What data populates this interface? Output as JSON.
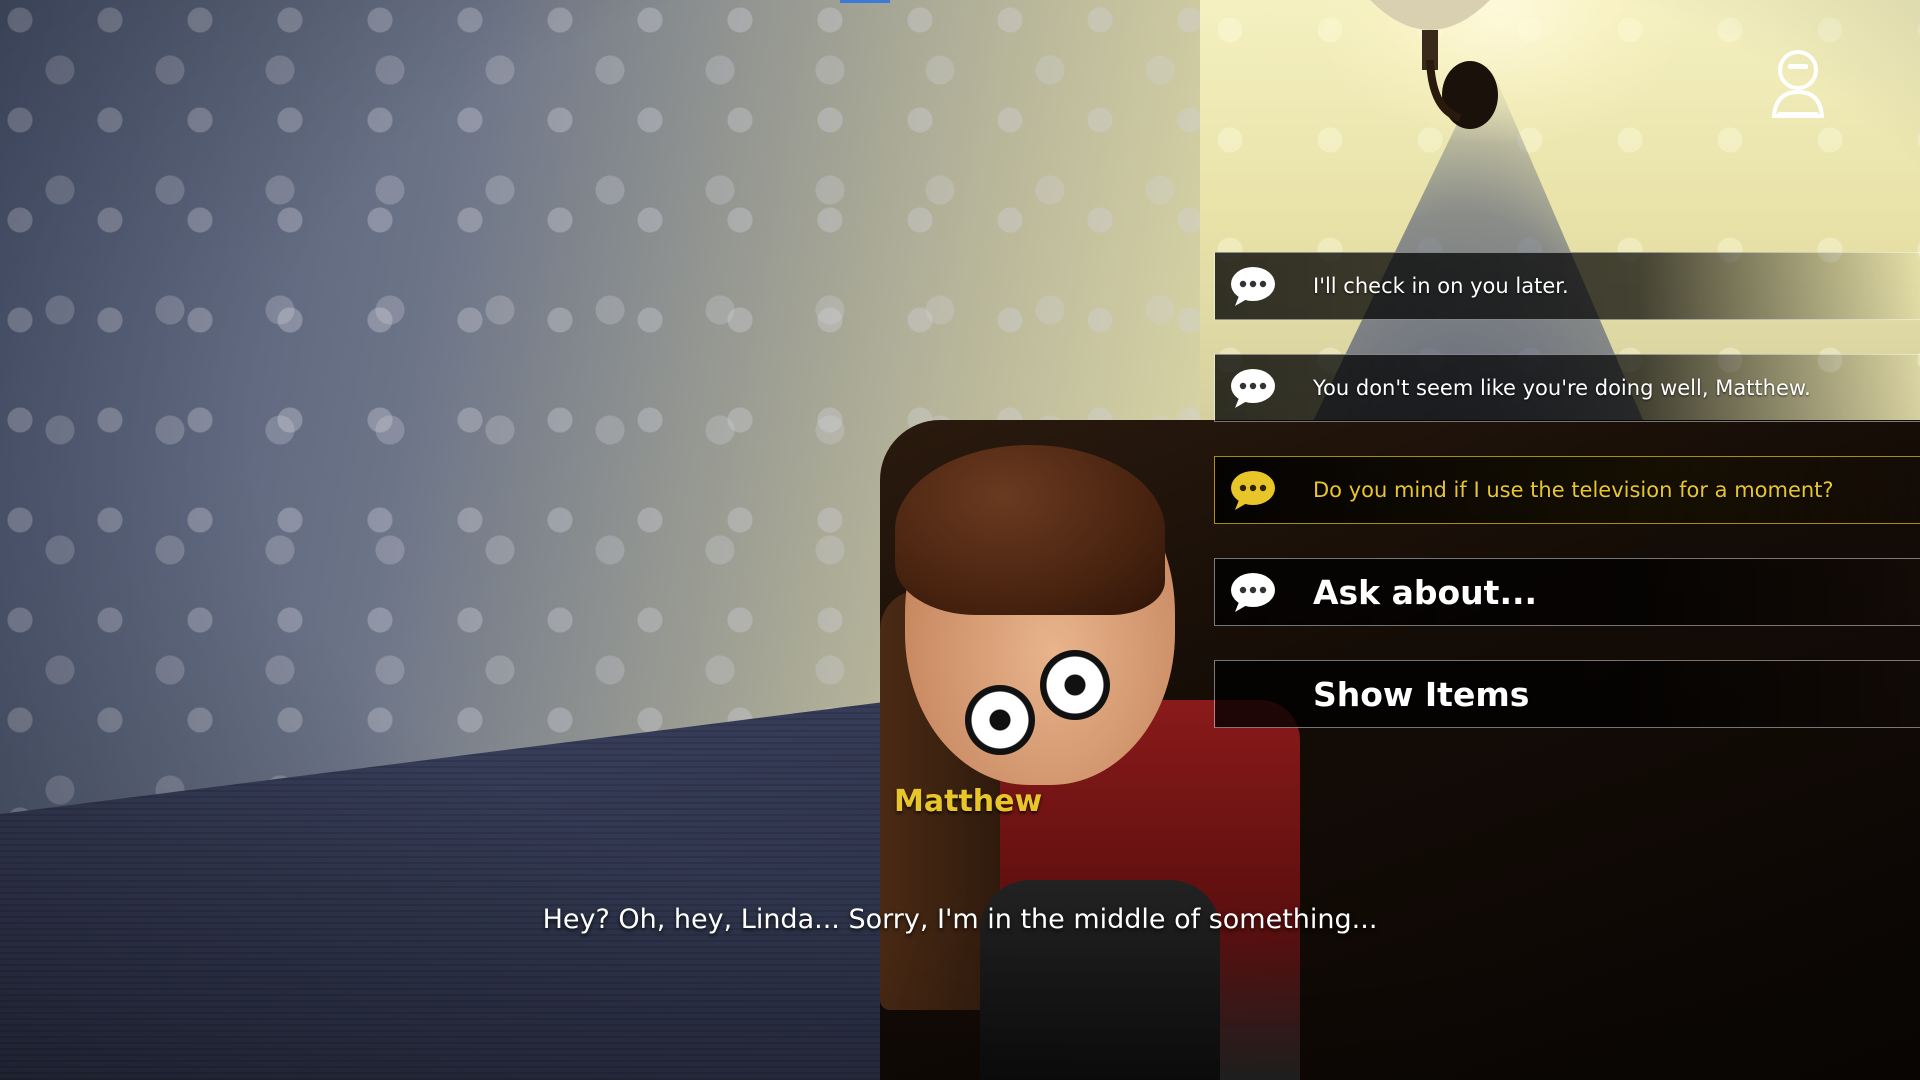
{
  "hud": {
    "profile_icon": "character-profile-icon"
  },
  "dialogue": {
    "speaker": "Matthew",
    "line": "Hey? Oh, hey, Linda... Sorry, I'm in the middle of something..."
  },
  "choices": [
    {
      "label": "I'll check in on you later.",
      "icon": "speech-bubble-icon",
      "selected": false
    },
    {
      "label": "You don't seem like you're doing well, Matthew.",
      "icon": "speech-bubble-icon",
      "selected": false
    },
    {
      "label": "Do you mind if I use the television for a moment?",
      "icon": "speech-bubble-icon",
      "selected": true
    },
    {
      "label": "Ask about...",
      "icon": "speech-bubble-icon",
      "selected": false
    },
    {
      "label": "Show Items",
      "icon": "",
      "selected": false
    }
  ],
  "colors": {
    "highlight": "#e8c62a",
    "text": "#ffffff",
    "panel": "#000000"
  }
}
